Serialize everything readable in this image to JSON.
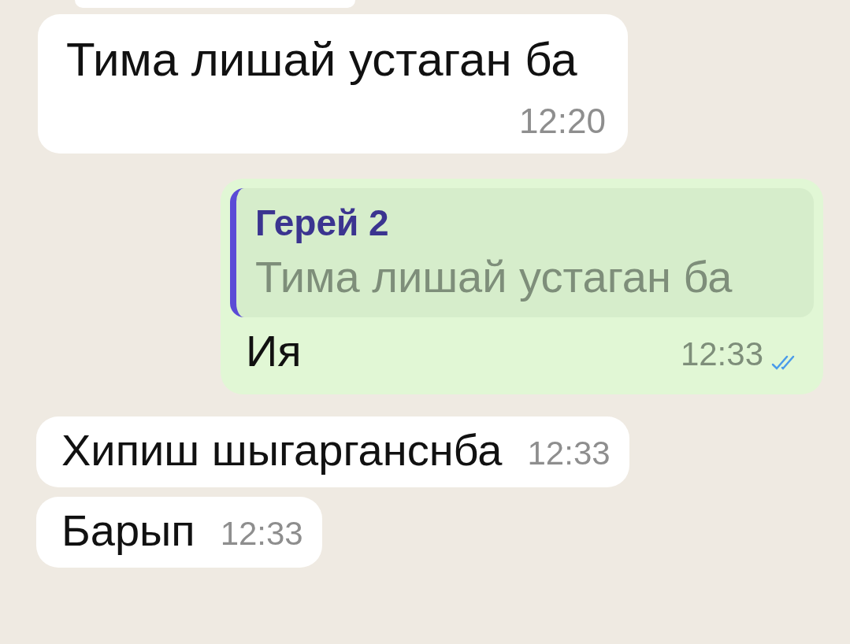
{
  "messages": [
    {
      "kind": "incoming",
      "text": "Тима лишай устаган ба",
      "time": "12:20",
      "time_below": true
    },
    {
      "kind": "outgoing",
      "reply": {
        "author": "Герей 2",
        "text": "Тима лишай устаган ба"
      },
      "text": "Ия",
      "time": "12:33",
      "read": true
    },
    {
      "kind": "incoming",
      "text": "Хипиш шыгарганснба",
      "time": "12:33",
      "time_below": false
    },
    {
      "kind": "incoming",
      "text": "Барып",
      "time": "12:33",
      "time_below": false
    }
  ]
}
